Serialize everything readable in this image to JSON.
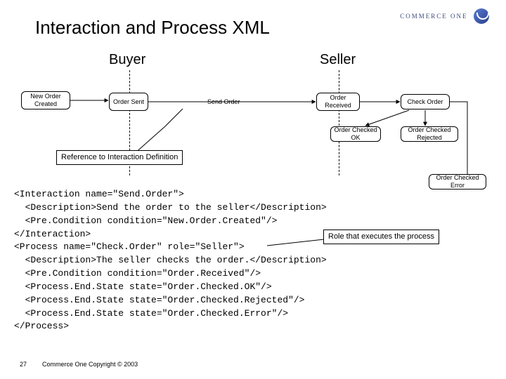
{
  "slide": {
    "number": "27",
    "title": "Interaction and Process XML",
    "copyright": "Commerce One Copyright © 2003",
    "logo_text": "COMMERCE\nONE"
  },
  "roles": {
    "buyer": "Buyer",
    "seller": "Seller"
  },
  "states": {
    "new_order_created": "New Order\nCreated",
    "order_sent": "Order\nSent",
    "send_order_msg": "Send Order",
    "order_received": "Order\nReceived",
    "check_order": "Check Order",
    "order_checked_ok": "Order\nChecked OK",
    "order_checked_rejected": "Order Checked\nRejected",
    "order_checked_error": "Order Checked\nError"
  },
  "callouts": {
    "reference_definition": "Reference to\nInteraction Definition",
    "role_executes": "Role that executes\nthe process"
  },
  "xml": "<Interaction name=\"Send.Order\">\n  <Description>Send the order to the seller</Description>\n  <Pre.Condition condition=\"New.Order.Created\"/>\n</Interaction>\n<Process name=\"Check.Order\" role=\"Seller\">\n  <Description>The seller checks the order.</Description>\n  <Pre.Condition condition=\"Order.Received\"/>\n  <Process.End.State state=\"Order.Checked.OK\"/>\n  <Process.End.State state=\"Order.Checked.Rejected\"/>\n  <Process.End.State state=\"Order.Checked.Error\"/>\n</Process>"
}
